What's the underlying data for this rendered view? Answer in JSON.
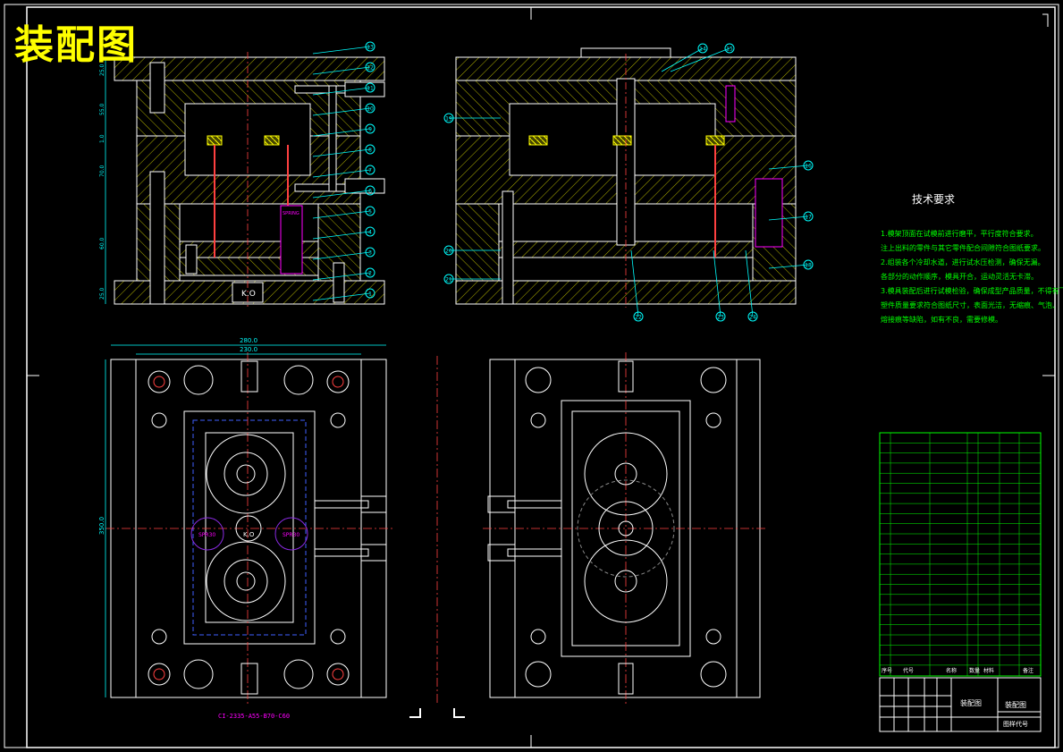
{
  "sheet": {
    "title": "装配图",
    "bottom_code": "CI-2335-A55-B70-C60"
  },
  "section_view": {
    "dims_vertical": [
      "25.0",
      "55.0",
      "1.0",
      "70.0",
      "60.0",
      "25.0"
    ],
    "ko_label": "K.O",
    "spring_label": "SPRING",
    "callouts_right": [
      "1",
      "2",
      "3",
      "4",
      "5",
      "6",
      "7",
      "8",
      "9",
      "10",
      "11",
      "12",
      "13"
    ]
  },
  "side_view": {
    "callouts_top": [
      "14",
      "15"
    ],
    "callouts_right": [
      "16",
      "17",
      "18"
    ],
    "callouts_left": [
      "19",
      "20",
      "21"
    ],
    "callouts_bottom": [
      "22",
      "23",
      "24"
    ]
  },
  "plan_view": {
    "dim_280": "280.0",
    "dim_230": "230.0",
    "dim_350": "350.0",
    "spring_left": "SPR30",
    "spring_right": "SPR30",
    "ko_label": "K.O"
  },
  "tech_requirements": {
    "heading": "技术要求",
    "lines": [
      "1.模架顶面在试模前进行磨平，平行度符合要求。",
      "注上出料的零件与其它零件配合间隙符合图纸要求。",
      "2.组装各个冷却水道，进行试水压检测，确保无漏。",
      "各部分的动作顺序，模具开合，运动灵活无卡滞。",
      "3.模具装配后进行试模检验，确保成型产品质量，不得有飞边。",
      "塑件质量要求符合图纸尺寸，表面光洁，无缩痕、气泡、",
      "熔接痕等缺陷，如有不良，需要修模。"
    ]
  },
  "title_block": {
    "drawing_name": "装配图",
    "drawing_name_right": "装配图",
    "code_label": "图样代号",
    "row_seq_header": "序号",
    "row_code_header": "代号",
    "row_name_header": "名称",
    "row_qty_header": "数量",
    "row_mat_header": "材料",
    "row_note_header": "备注"
  }
}
